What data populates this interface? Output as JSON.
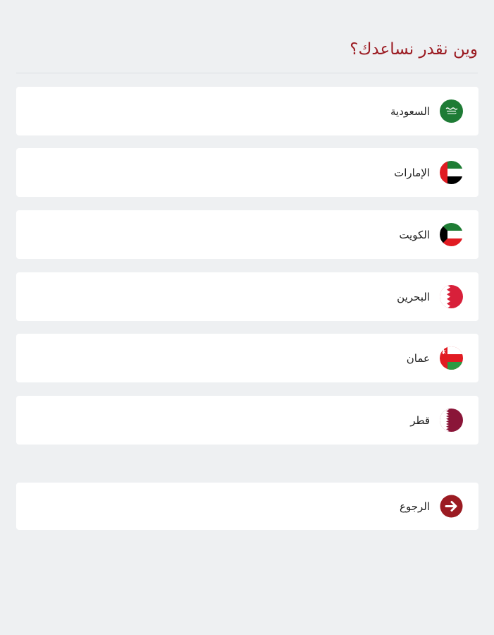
{
  "page": {
    "title": "وين نقدر نساعدك؟"
  },
  "countries": [
    {
      "label": "السعودية",
      "flag_icon": "saudi-flag-icon",
      "colors": {
        "primary": "#1e7b35",
        "secondary": "#ffffff"
      }
    },
    {
      "label": "الإمارات",
      "flag_icon": "uae-flag-icon",
      "colors": {
        "red": "#e11b22",
        "green": "#1f7d35",
        "white": "#ffffff",
        "black": "#000000"
      }
    },
    {
      "label": "الكويت",
      "flag_icon": "kuwait-flag-icon",
      "colors": {
        "green": "#1f7d35",
        "white": "#ffffff",
        "red": "#e11b22",
        "black": "#000000"
      }
    },
    {
      "label": "البحرين",
      "flag_icon": "bahrain-flag-icon",
      "colors": {
        "red": "#d8203a",
        "white": "#ffffff"
      }
    },
    {
      "label": "عمان",
      "flag_icon": "oman-flag-icon",
      "colors": {
        "red": "#e11b22",
        "white": "#ffffff",
        "green": "#2c9a43"
      }
    },
    {
      "label": "قطر",
      "flag_icon": "qatar-flag-icon",
      "colors": {
        "maroon": "#8a1538",
        "white": "#ffffff"
      }
    }
  ],
  "back": {
    "label": "الرجوع",
    "icon": "arrow-right-circle-icon",
    "color": "#9b1b22"
  },
  "colors": {
    "accent": "#9b1b22",
    "background": "#eef0f2",
    "card": "#ffffff",
    "text": "#1d1d1d"
  }
}
